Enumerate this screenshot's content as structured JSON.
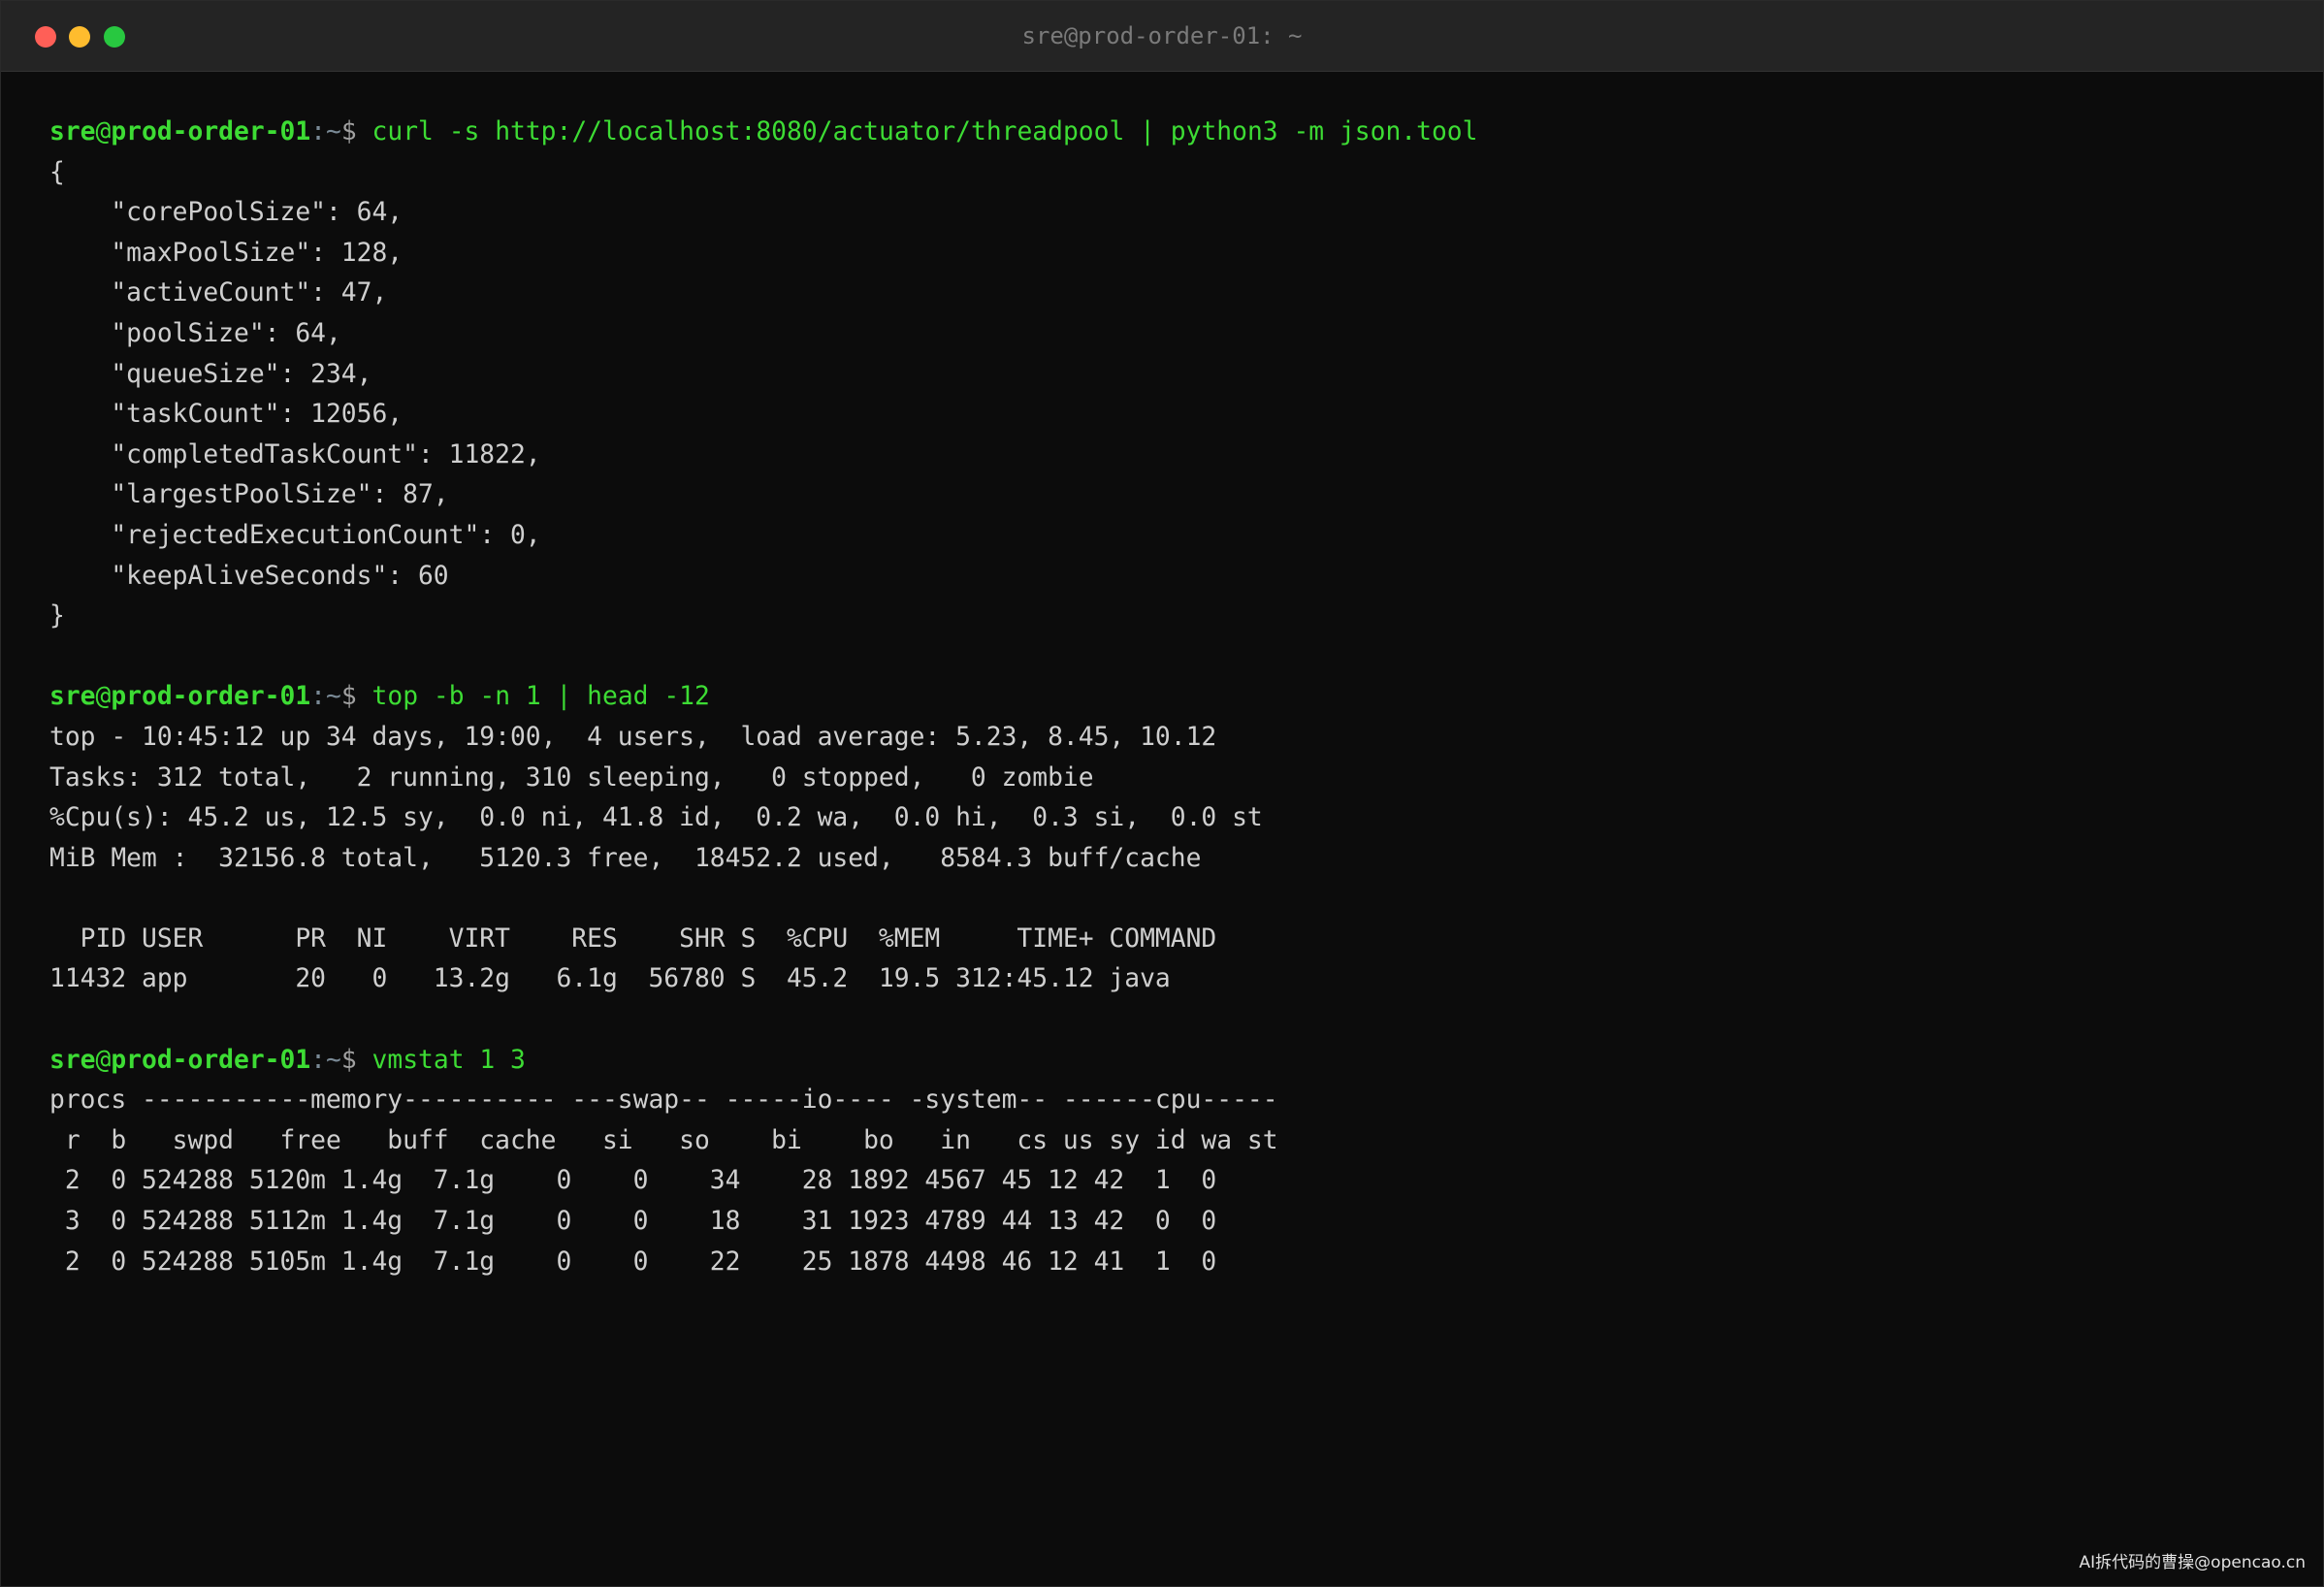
{
  "window": {
    "title": "sre@prod-order-01: ~"
  },
  "prompt": {
    "user": "sre",
    "at": "@",
    "host": "prod-order-01",
    "sep": ":",
    "path": "~",
    "sign": "$ "
  },
  "blocks": [
    {
      "command": "curl -s http://localhost:8080/actuator/threadpool | python3 -m json.tool",
      "output": [
        "{",
        "    \"corePoolSize\": 64,",
        "    \"maxPoolSize\": 128,",
        "    \"activeCount\": 47,",
        "    \"poolSize\": 64,",
        "    \"queueSize\": 234,",
        "    \"taskCount\": 12056,",
        "    \"completedTaskCount\": 11822,",
        "    \"largestPoolSize\": 87,",
        "    \"rejectedExecutionCount\": 0,",
        "    \"keepAliveSeconds\": 60",
        "}",
        ""
      ]
    },
    {
      "command": "top -b -n 1 | head -12",
      "output": [
        "top - 10:45:12 up 34 days, 19:00,  4 users,  load average: 5.23, 8.45, 10.12",
        "Tasks: 312 total,   2 running, 310 sleeping,   0 stopped,   0 zombie",
        "%Cpu(s): 45.2 us, 12.5 sy,  0.0 ni, 41.8 id,  0.2 wa,  0.0 hi,  0.3 si,  0.0 st",
        "MiB Mem :  32156.8 total,   5120.3 free,  18452.2 used,   8584.3 buff/cache",
        "",
        "  PID USER      PR  NI    VIRT    RES    SHR S  %CPU  %MEM     TIME+ COMMAND",
        "11432 app       20   0   13.2g   6.1g  56780 S  45.2  19.5 312:45.12 java",
        ""
      ]
    },
    {
      "command": "vmstat 1 3",
      "output": [
        "procs -----------memory---------- ---swap-- -----io---- -system-- ------cpu-----",
        " r  b   swpd   free   buff  cache   si   so    bi    bo   in   cs us sy id wa st",
        " 2  0 524288 5120m 1.4g  7.1g    0    0    34    28 1892 4567 45 12 42  1  0",
        " 3  0 524288 5112m 1.4g  7.1g    0    0    18    31 1923 4789 44 13 42  0  0",
        " 2  0 524288 5105m 1.4g  7.1g    0    0    22    25 1878 4498 46 12 41  1  0"
      ]
    }
  ],
  "watermark": "AI拆代码的曹操@opencao.cn",
  "colors": {
    "background": "#0c0c0c",
    "prompt_green": "#3ddc34",
    "text": "#cfcfcf"
  }
}
